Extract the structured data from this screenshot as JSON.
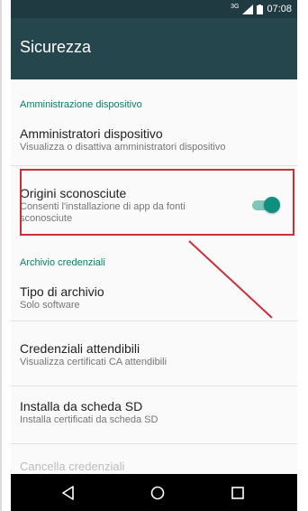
{
  "status_bar": {
    "network": "3G",
    "time": "07:08",
    "icons": [
      "signal-icon",
      "battery-icon"
    ]
  },
  "app_bar": {
    "title": "Sicurezza"
  },
  "sections": {
    "device_admin": {
      "header": "Amministrazione dispositivo",
      "admins": {
        "title": "Amministratori dispositivo",
        "subtitle": "Visualizza o disattiva amministratori dispositivo"
      },
      "unknown_sources": {
        "title": "Origini sconosciute",
        "subtitle_line1": "Consenti l'installazione di app da fonti",
        "subtitle_line2": "sconosciute",
        "toggle_on": true
      }
    },
    "credential_storage": {
      "header": "Archivio credenziali",
      "storage_type": {
        "title": "Tipo di archivio",
        "subtitle": "Solo software"
      },
      "trusted": {
        "title": "Credenziali attendibili",
        "subtitle": "Visualizza certificati CA attendibili"
      },
      "install_sd": {
        "title": "Installa da scheda SD",
        "subtitle": "Installa certificati da scheda SD"
      },
      "clear": {
        "title": "Cancella credenziali"
      }
    }
  },
  "nav_bar": {
    "icons": [
      "back-icon",
      "home-icon",
      "recents-icon"
    ]
  },
  "colors": {
    "status_bar": "#1f3a40",
    "app_bar": "#25464d",
    "accent": "#0f8f7e",
    "highlight": "#c8323a",
    "nav_bar": "#000000"
  }
}
